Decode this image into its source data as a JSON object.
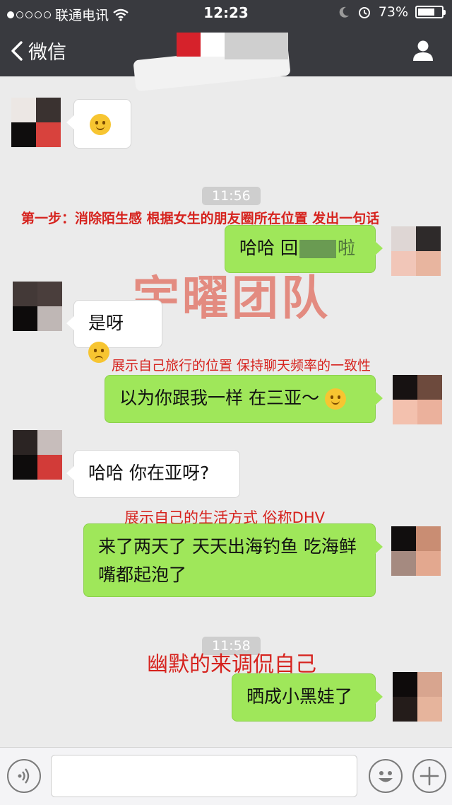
{
  "status_bar": {
    "carrier": "联通电讯",
    "time": "12:23",
    "battery": "73%",
    "battery_level": 0.73
  },
  "nav": {
    "back_label": "微信"
  },
  "messages": [
    {
      "text": "",
      "emoji": "smile"
    },
    {
      "text": "哈哈 回",
      "text_tail": "啦"
    },
    {
      "text": "是呀",
      "emoji": "sad"
    },
    {
      "text": "以为你跟我一样 在三亚～",
      "emoji": "thinking"
    },
    {
      "text": "哈哈 你在亚呀?"
    },
    {
      "text": "来了两天了 天天出海钓鱼 吃海鲜 嘴都起泡了"
    },
    {
      "text": "晒成小黑娃了"
    }
  ],
  "timestamps": [
    "11:56",
    "11:58"
  ],
  "annotations": {
    "step1": "第一步：消除陌生感 根据女生的朋友圈所在位置 发出一句话",
    "step2": "展示自己旅行的位置 保持聊天频率的一致性",
    "step3": "展示自己的生活方式 俗称DHV",
    "step4": "幽默的来调侃自己",
    "watermark": "宇曜团队"
  },
  "colors": {
    "header": "#393a3f",
    "bubble_self": "#9fe75a",
    "bubble_other": "#ffffff",
    "annotation": "#d6231e"
  }
}
